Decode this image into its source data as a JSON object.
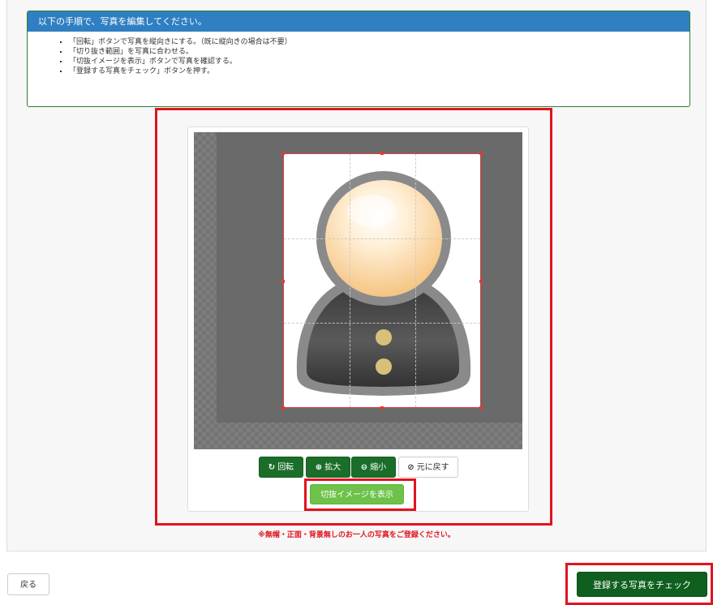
{
  "instructions": {
    "heading": "以下の手順で、写真を編集してください。",
    "steps": [
      "「回転」ボタンで写真を縦向きにする。（既に縦向きの場合は不要）",
      "「切り抜き範囲」を写真に合わせる。",
      "「切抜イメージを表示」ボタンで写真を確認する。",
      "「登録する写真をチェック」ボタンを押す。"
    ]
  },
  "toolbar": {
    "rotate_label": "回転",
    "zoom_in_label": "拡大",
    "zoom_out_label": "縮小",
    "reset_label": "元に戻す",
    "preview_label": "切抜イメージを表示"
  },
  "notice": "※無帽・正面・背景無しのお一人の写真をご登録ください。",
  "footer": {
    "back_label": "戻る",
    "submit_label": "登録する写真をチェック"
  },
  "icons": {
    "rotate": "rotate-icon",
    "zoom_in": "zoom-in-icon",
    "zoom_out": "zoom-out-icon",
    "reset": "reset-icon"
  },
  "colors": {
    "header_blue": "#2f7fc2",
    "primary_green": "#1b6e2a",
    "preview_green": "#6ec24a",
    "highlight_red": "#e0141e"
  }
}
